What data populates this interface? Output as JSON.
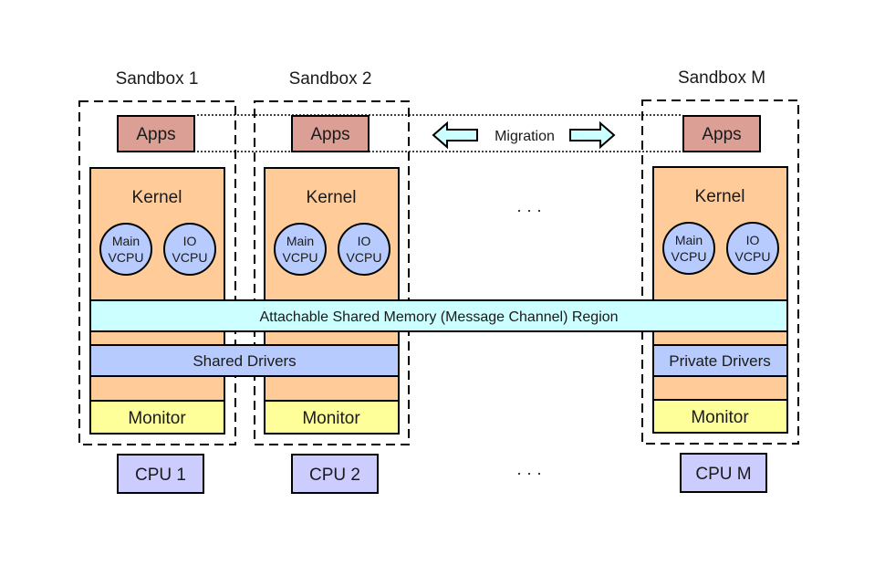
{
  "sandboxes": [
    {
      "title": "Sandbox 1",
      "apps": "Apps",
      "kernel": "Kernel",
      "vcpu_main": [
        "Main",
        "VCPU"
      ],
      "vcpu_io": [
        "IO",
        "VCPU"
      ],
      "monitor": "Monitor",
      "cpu": "CPU 1"
    },
    {
      "title": "Sandbox 2",
      "apps": "Apps",
      "kernel": "Kernel",
      "vcpu_main": [
        "Main",
        "VCPU"
      ],
      "vcpu_io": [
        "IO",
        "VCPU"
      ],
      "monitor": "Monitor",
      "cpu": "CPU 2"
    },
    {
      "title": "Sandbox M",
      "apps": "Apps",
      "kernel": "Kernel",
      "vcpu_main": [
        "Main",
        "VCPU"
      ],
      "vcpu_io": [
        "IO",
        "VCPU"
      ],
      "monitor": "Monitor",
      "cpu": "CPU M",
      "drivers": "Private Drivers"
    }
  ],
  "migration": "Migration",
  "shared_memory": "Attachable Shared Memory (Message Channel) Region",
  "shared_drivers": "Shared Drivers",
  "ellipsis": "· · ·",
  "colors": {
    "apps": "#dc9f96",
    "kernel": "#ffcc99",
    "vcpu": "#b7cbff",
    "shared_memory": "#ccffff",
    "drivers": "#b7cbff",
    "monitor": "#ffff99",
    "cpu": "#ccccff",
    "migration_arrow": "#ccffff"
  }
}
